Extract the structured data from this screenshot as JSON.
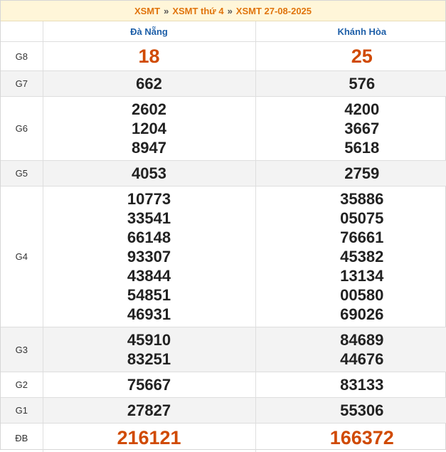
{
  "breadcrumb": {
    "home": "XSMT",
    "day": "XSMT thứ 4",
    "date": "XSMT 27-08-2025"
  },
  "provinces": [
    "Đà Nẵng",
    "Khánh Hòa"
  ],
  "rows": [
    {
      "label": "G8",
      "values": [
        [
          "18"
        ],
        [
          "25"
        ]
      ],
      "special": true,
      "alt": false
    },
    {
      "label": "G7",
      "values": [
        [
          "662"
        ],
        [
          "576"
        ]
      ],
      "special": false,
      "alt": true
    },
    {
      "label": "G6",
      "values": [
        [
          "2602",
          "1204",
          "8947"
        ],
        [
          "4200",
          "3667",
          "5618"
        ]
      ],
      "special": false,
      "alt": false
    },
    {
      "label": "G5",
      "values": [
        [
          "4053"
        ],
        [
          "2759"
        ]
      ],
      "special": false,
      "alt": true
    },
    {
      "label": "G4",
      "values": [
        [
          "10773",
          "33541",
          "66148",
          "93307",
          "43844",
          "54851",
          "46931"
        ],
        [
          "35886",
          "05075",
          "76661",
          "45382",
          "13134",
          "00580",
          "69026"
        ]
      ],
      "special": false,
      "alt": false
    },
    {
      "label": "G3",
      "values": [
        [
          "45910",
          "83251"
        ],
        [
          "84689",
          "44676"
        ]
      ],
      "special": false,
      "alt": true
    },
    {
      "label": "G2",
      "values": [
        [
          "75667"
        ],
        [
          "83133"
        ]
      ],
      "special": false,
      "alt": false
    },
    {
      "label": "G1",
      "values": [
        [
          "27827"
        ],
        [
          "55306"
        ]
      ],
      "special": false,
      "alt": true
    },
    {
      "label": "ĐB",
      "values": [
        [
          "216121"
        ],
        [
          "166372"
        ]
      ],
      "special": true,
      "alt": false
    }
  ],
  "colors": {
    "accent": "#e0740c",
    "province": "#1e5fa8",
    "special": "#d04a02",
    "header_bg": "#fff6d9",
    "alt_row": "#f3f3f3"
  }
}
